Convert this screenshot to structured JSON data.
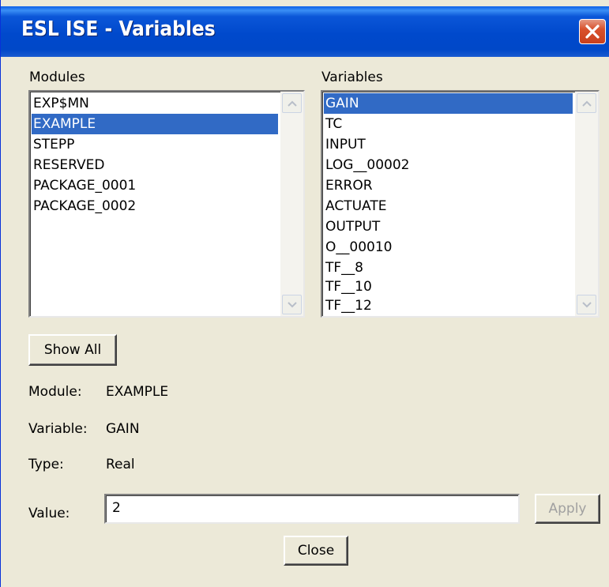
{
  "window": {
    "title": "ESL ISE - Variables",
    "title_bar_color": "#0054e3",
    "face_color": "#ece9d8",
    "selection_color": "#316ac5"
  },
  "modules": {
    "label": "Modules",
    "items": [
      "EXP$MN",
      "EXAMPLE",
      "STEPP",
      "RESERVED",
      "PACKAGE_0001",
      "PACKAGE_0002"
    ],
    "selected": "EXAMPLE"
  },
  "variables": {
    "label": "Variables",
    "items": [
      "GAIN",
      "TC",
      "INPUT",
      "LOG__00002",
      "ERROR",
      "ACTUATE",
      "OUTPUT",
      "O__00010",
      "TF__8",
      "TF__10",
      "TF__12"
    ],
    "selected": "GAIN"
  },
  "buttons": {
    "show_all": "Show All",
    "apply": "Apply",
    "close": "Close"
  },
  "details": {
    "module_label": "Module:",
    "module_value": "EXAMPLE",
    "variable_label": "Variable:",
    "variable_value": "GAIN",
    "type_label": "Type:",
    "type_value": "Real",
    "value_label": "Value:",
    "value": "2"
  },
  "icons": {
    "close": "close-x-icon",
    "scroll_up": "scroll-up-arrow-icon",
    "scroll_down": "scroll-down-arrow-icon"
  }
}
